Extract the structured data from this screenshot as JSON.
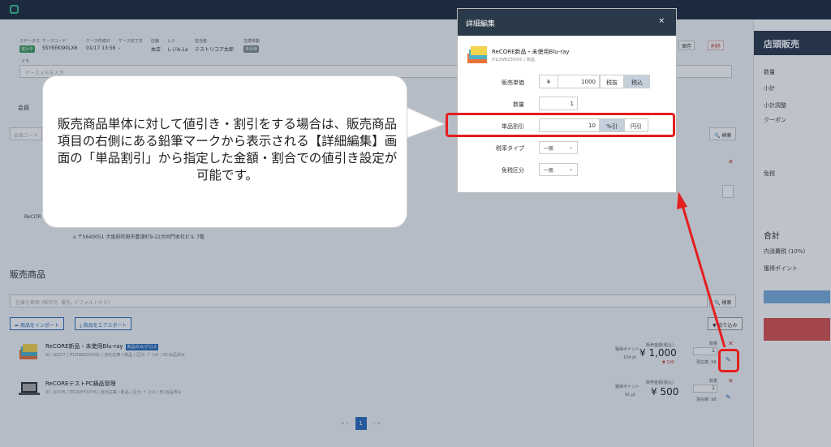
{
  "header": {},
  "status_bar": {
    "status_label": "ステータス",
    "status_value": "進行中",
    "case_code_label": "ケースコード",
    "case_code_value": "SSYEEKI90LX6",
    "created_label": "ケース作成日",
    "created_value": "01/17 13:56",
    "completed_label": "ケース完了日",
    "completed_value": "-",
    "store_label": "店舗",
    "store_value": "本店",
    "register_label": "レジ",
    "register_value": "レジA-1a",
    "staff_label": "担当者",
    "staff_value": "テストリコア太郎",
    "stock_label": "在庫移動",
    "stock_value": "未反映"
  },
  "actions": {
    "save": "保存",
    "delete": "削除"
  },
  "memo": {
    "label": "メモ",
    "placeholder": "ケースメモを入力"
  },
  "member": {
    "tab": "会員",
    "placeholder": "会員コード",
    "search": "検索"
  },
  "customer": {
    "name_short": "ReCOR",
    "address": "〒5640051 大阪府吹田市豊津町9-22大同門本社ビル 7階"
  },
  "products_section": {
    "title": "販売商品",
    "search_placeholder": "在庫を検索 (販売可, 優先: デフォルトから)",
    "search": "検索",
    "import": "商品をインポート",
    "export": "商品をエクスポート",
    "filter": "絞り込み",
    "rows": [
      {
        "name": "ReCORE新品・未使用Blu-ray",
        "tag": "新品のみ/グロス",
        "sub": "ID: 10377 / ITLOW8Z3VIOC / 自社在庫 / 新品 / 区分: ﾃﾞﾌｫﾙﾄ / EC出品済み",
        "points_label": "獲得ポイント",
        "points": "104 pt",
        "price_label": "販売金額(税込)",
        "price": "¥ 1,000",
        "discount": "▼ 100",
        "qty_label": "数量",
        "qty": "1",
        "stock": "現在庫: 98"
      },
      {
        "name": "ReCOREテストPC鍋品管理",
        "sub": "ID: 10376 / ITC0DYYXXY6 / 自社在庫 / 新品 / 区分: ﾃﾞﾌｫﾙﾄ / EC出品済み",
        "points_label": "獲得ポイント",
        "points": "91 pt",
        "price_label": "販売金額(税込)",
        "price": "¥ 500",
        "qty_label": "数量",
        "qty": "1",
        "stock": "現在庫: 98"
      }
    ],
    "pager": {
      "prev2": "«",
      "prev": "‹",
      "current": "1",
      "next": "›",
      "next2": "»"
    }
  },
  "right_panel": {
    "title": "店頭販売",
    "items": [
      "数量",
      "小計",
      "小計調整",
      "クーポン",
      "免税"
    ],
    "total_label": "合計",
    "tax_label": "内消費税 (10%)",
    "points_label": "獲得ポイント"
  },
  "modal": {
    "title": "詳細編集",
    "close": "×",
    "product_name": "ReCORE新品・未使用Blu-ray",
    "product_sub": "ITLOW8Z3VIOC / 新品",
    "price_label": "販売単価",
    "currency": "¥",
    "price_value": "1000",
    "tax_excluded": "税抜",
    "tax_included": "税込",
    "qty_label": "数量",
    "qty_value": "1",
    "discount_label": "単品割引",
    "discount_value": "10",
    "percent_off": "%引",
    "yen_off": "円引",
    "tax_type_label": "税率タイプ",
    "tax_type_value": "一般",
    "tax_free_label": "免税区分",
    "tax_free_value": "一般"
  },
  "callout": {
    "text": "販売商品単体に対して値引き・割引をする場合は、販売商品項目の右側にある鉛筆マークから表示される【詳細編集】画面の「単品割引」から指定した金額・割合での値引き設定が可能です。"
  },
  "colors": {
    "accent": "#2a6ebb",
    "highlight": "#e31f1f",
    "header": "#2b3a4a"
  }
}
